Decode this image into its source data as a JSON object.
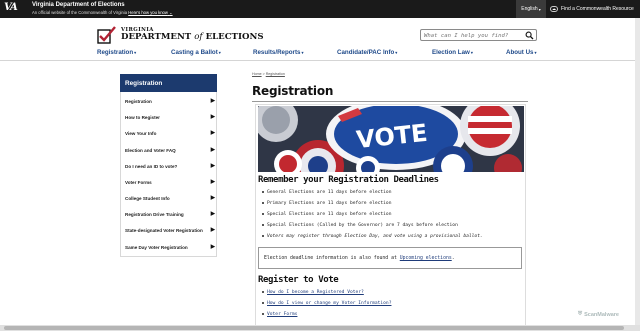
{
  "topbar": {
    "logo_text": "VA",
    "title": "Virginia Department of Elections",
    "subtitle": "An official website of the Commonwealth of Virginia",
    "how_link": "Here's how you know",
    "language": "English",
    "resource": "Find a Commonwealth Resource"
  },
  "header": {
    "logo_line1": "VIRGINIA",
    "logo_line2_a": "DEPARTMENT",
    "logo_line2_of": "of",
    "logo_line2_b": "ELECTIONS",
    "search_placeholder": "What can I help you find?"
  },
  "nav": {
    "items": [
      {
        "label": "Registration"
      },
      {
        "label": "Casting a Ballot"
      },
      {
        "label": "Results/Reports"
      },
      {
        "label": "Candidate/PAC Info"
      },
      {
        "label": "Election Law"
      },
      {
        "label": "About Us"
      }
    ]
  },
  "sidebar": {
    "heading": "Registration",
    "items": [
      {
        "label": "Registration"
      },
      {
        "label": "How to Register"
      },
      {
        "label": "View Your Info"
      },
      {
        "label": "Election and Voter FAQ"
      },
      {
        "label": "Do I need an ID to vote?"
      },
      {
        "label": "Voter Forms"
      },
      {
        "label": "College Student Info"
      },
      {
        "label": "Registration Drive Training"
      },
      {
        "label": "State-designated Voter Registration"
      },
      {
        "label": "Same Day Voter Registration"
      }
    ]
  },
  "breadcrumb": {
    "home": "Home",
    "sep": ">",
    "current": "Registration"
  },
  "main": {
    "title": "Registration",
    "hero_text": "VOTE",
    "deadlines_heading": "Remember your Registration Deadlines",
    "deadlines": [
      "General Elections are 11 days before election",
      "Primary Elections are 11 days before election",
      "Special Elections are 11 days before election",
      "Special Elections (Called by the Governor) are 7 days before election",
      "Voters may register through Election Day, and vote using a provisional ballot."
    ],
    "note_text": "Election deadline information is also found at ",
    "note_link": "Upcoming elections",
    "note_end": ".",
    "register_heading": "Register to Vote",
    "register_links": [
      "How do I become a Registered Voter?",
      "How do I view or change my Voter Information?",
      "Voter Forms"
    ]
  },
  "watermark": "ScanMalware"
}
